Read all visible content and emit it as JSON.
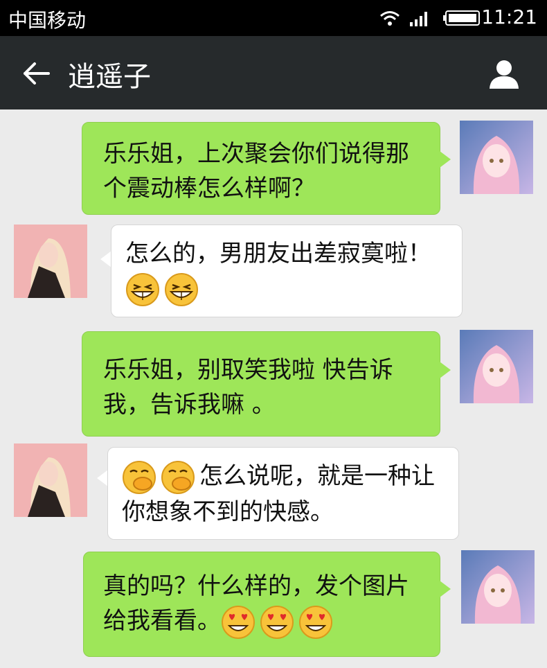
{
  "status": {
    "carrier": "中国移动",
    "time": "11:21"
  },
  "header": {
    "title": "逍遥子"
  },
  "messages": [
    {
      "side": "out",
      "text": "乐乐姐，上次聚会你们说得那个震动棒怎么样啊？"
    },
    {
      "side": "in",
      "text": "怎么的，男朋友出差寂寞啦！",
      "emoji_after": [
        "grin-emoji",
        "grin-emoji"
      ]
    },
    {
      "side": "out",
      "text": "乐乐姐，别取笑我啦  快告诉我，告诉我嘛 。"
    },
    {
      "side": "in",
      "emoji_before": [
        "hand-over-mouth-emoji",
        "hand-over-mouth-emoji"
      ],
      "text": "怎么说呢，就是一种让你想象不到的快感。"
    },
    {
      "side": "out",
      "text": "真的吗？什么样的，发个图片给我看看。",
      "emoji_after": [
        "heart-eyes-emoji",
        "heart-eyes-emoji",
        "heart-eyes-emoji"
      ]
    }
  ],
  "colors": {
    "out_bubble": "#9ee659",
    "in_bubble": "#ffffff",
    "background": "#ebebeb",
    "titlebar": "#262a2c"
  }
}
